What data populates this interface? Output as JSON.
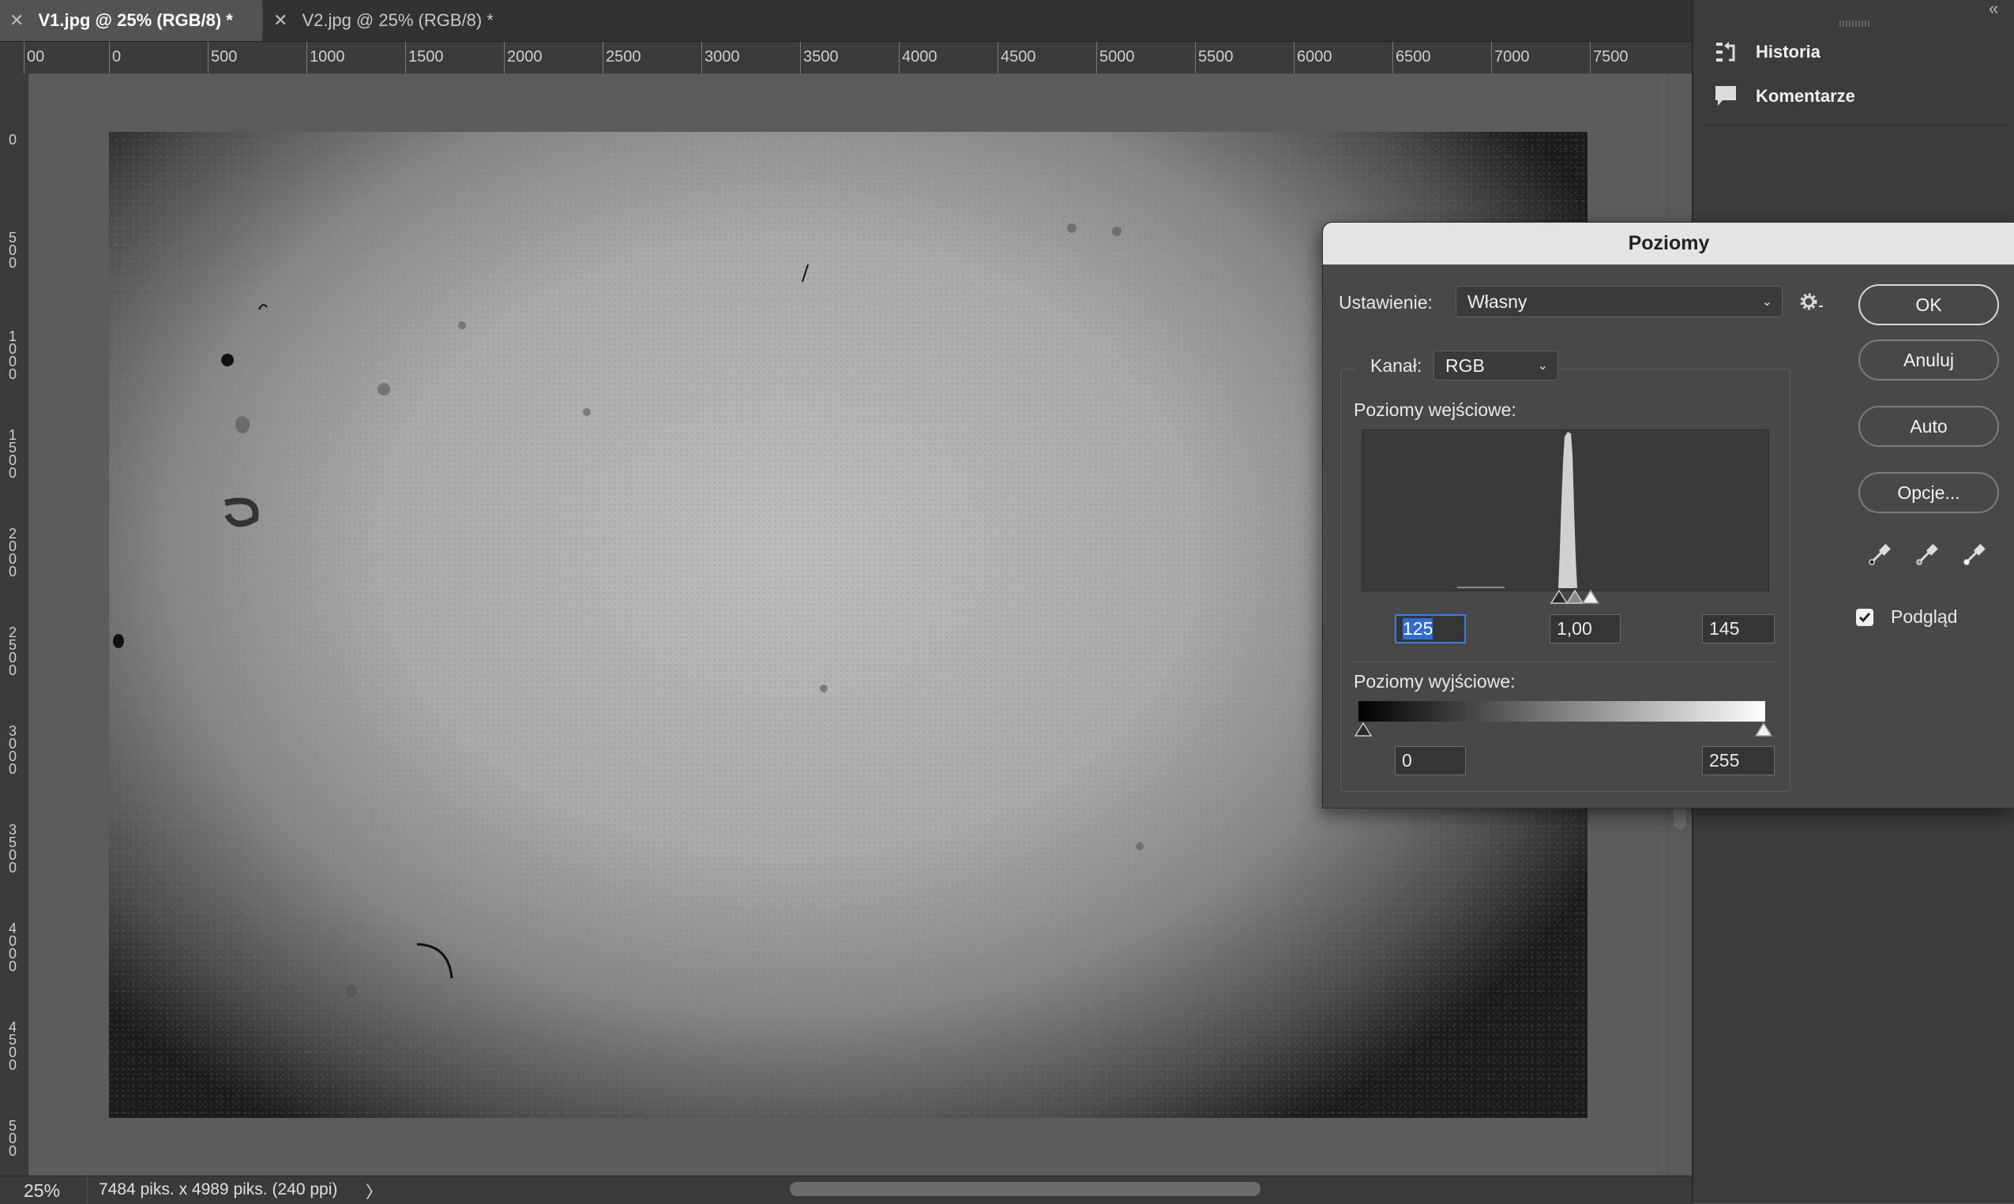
{
  "tabs": [
    {
      "label": "V1.jpg @ 25% (RGB/8) *",
      "active": true
    },
    {
      "label": "V2.jpg @ 25% (RGB/8) *",
      "active": false
    }
  ],
  "ruler": {
    "horizontal_labels": [
      "00",
      "0",
      "500",
      "1000",
      "1500",
      "2000",
      "2500",
      "3000",
      "3500",
      "4000",
      "4500",
      "5000",
      "5500",
      "6000",
      "6500",
      "7000",
      "7500"
    ],
    "vertical_labels": [
      "0",
      "500",
      "1000",
      "1500",
      "2000",
      "2500",
      "3000",
      "3500",
      "4000",
      "4500",
      "500"
    ]
  },
  "status": {
    "zoom": "25%",
    "doc_info": "7484 piks. x 4989 piks. (240 ppi)",
    "arrow": "〉"
  },
  "panel": {
    "collapse_icon": "«",
    "items": [
      {
        "label": "Historia",
        "icon": "history-icon"
      },
      {
        "label": "Komentarze",
        "icon": "comment-icon"
      }
    ]
  },
  "dialog": {
    "title": "Poziomy",
    "preset_label": "Ustawienie:",
    "preset_value": "Własny",
    "channel_label": "Kanał:",
    "channel_value": "RGB",
    "input_levels_label": "Poziomy wejściowe:",
    "input_black": "125",
    "input_gamma": "1,00",
    "input_white": "145",
    "output_levels_label": "Poziomy wyjściowe:",
    "output_black": "0",
    "output_white": "255",
    "buttons": {
      "ok": "OK",
      "cancel": "Anuluj",
      "auto": "Auto",
      "options": "Opcje..."
    },
    "preview_label": "Podgląd",
    "preview_checked": true
  },
  "colors": {
    "accent": "#2f6bd0",
    "dialog_bg": "#484848",
    "title_bg": "#e4e4e4"
  }
}
